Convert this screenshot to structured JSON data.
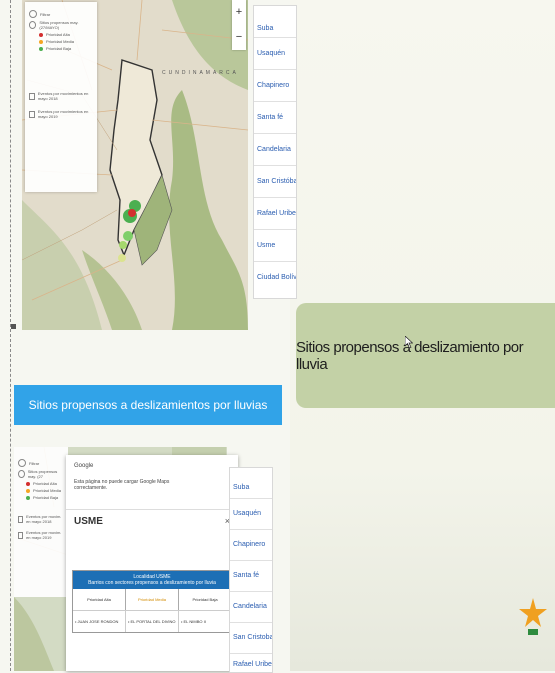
{
  "map_top": {
    "legend": {
      "title": "Filtrar",
      "layer_label": "Sitios propensos may. (27/MAYO)",
      "levels": [
        "Prioridad Alta",
        "Prioridad Media",
        "Prioridad Baja"
      ],
      "events": [
        "Eventos por movimientos en mayo 2018",
        "Eventos por movimientos en mayo 2019"
      ]
    },
    "map_labels": [
      "CUNDINAMARCA"
    ],
    "zoom_in": "+",
    "zoom_out": "−"
  },
  "localities_top": [
    "Suba",
    "Usaquén",
    "Chapinero",
    "Santa fé",
    "Candelaria",
    "San Cristóbal",
    "Rafael Uribe Uribe",
    "Usme",
    "Ciudad Bolívar"
  ],
  "banner_title": "Sitios propensos a deslizamientos por lluvias",
  "map_bottom": {
    "legend": {
      "title": "Filtrar",
      "layer_label": "Sitios propensos may. (27",
      "levels": [
        "Prioridad Alta",
        "Prioridad Media",
        "Prioridad Baja"
      ],
      "events": [
        "Eventos por movim. en mayo 2018",
        "Eventos por movim. en mayo 2019"
      ]
    }
  },
  "dialog": {
    "google_title": "Google",
    "google_message": "Esta página no puede cargar Google Maps correctamente.",
    "locality_name": "USME",
    "close_icon": "×",
    "table_title": "Localidad USME",
    "table_subtitle": "Barrios con sectores propensos a deslizamiento por lluvia",
    "columns": [
      "Prioridad Alta",
      "Prioridad Media",
      "Prioridad Baja"
    ],
    "row": [
      "• JUAN JOSE RONDON",
      "• EL PORTAL DEL DIVINO",
      "• EL NIMBO II"
    ]
  },
  "localities_bottom": [
    "Suba",
    "Usaquén",
    "Chapinero",
    "Santa fé",
    "Candelaria",
    "San Cristobal",
    "Rafael Uribe Uribe"
  ],
  "callout_text": "Sitios propensos a deslizamiento por lluvia",
  "colors": {
    "banner": "#31a3e8",
    "callout": "#c3d1a6",
    "priority_high": "#d32f2f",
    "priority_medium": "#f5a623",
    "priority_low": "#4caf50",
    "table_header": "#1d6fb5"
  },
  "icons": [
    "map-marker-icon",
    "cursor-icon",
    "star-logo-icon",
    "close-icon",
    "checkbox-icon"
  ]
}
